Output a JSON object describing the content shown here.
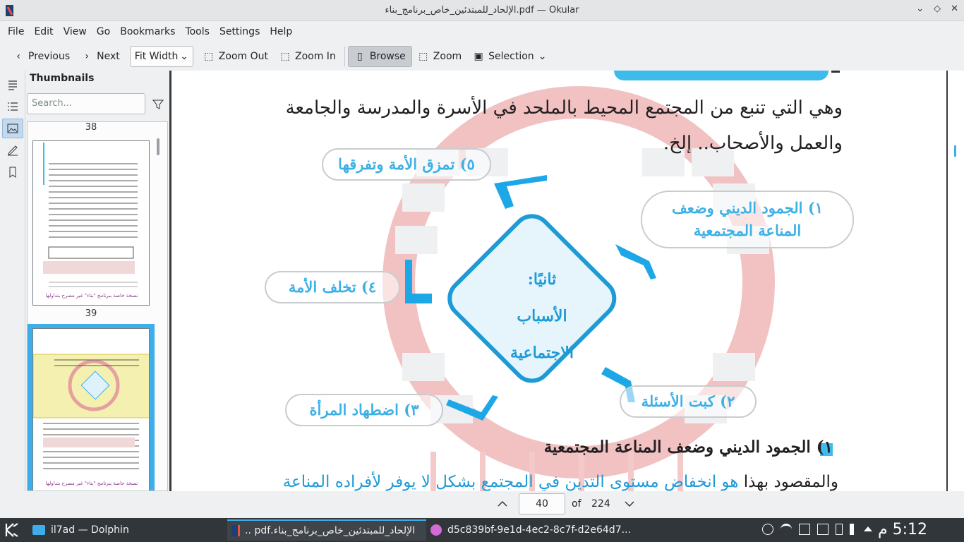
{
  "window": {
    "title": "الإلحاد_للمبتدئين_خاص_برنامج_بناء.pdf — Okular"
  },
  "menu": [
    "File",
    "Edit",
    "View",
    "Go",
    "Bookmarks",
    "Tools",
    "Settings",
    "Help"
  ],
  "toolbar": {
    "previous": "Previous",
    "next": "Next",
    "zoom_mode": "Fit Width",
    "zoom_out": "Zoom Out",
    "zoom_in": "Zoom In",
    "browse": "Browse",
    "zoom": "Zoom",
    "selection": "Selection"
  },
  "sidebar": {
    "heading": "Thumbnails",
    "search_placeholder": "Search...",
    "thumbnails": [
      {
        "page": "38"
      },
      {
        "page": "39"
      },
      {
        "page": "40",
        "selected": true
      }
    ],
    "thumb_footer": "نسخة خاصة ببرنامج \"بناء\" غير مصرح بتداولها"
  },
  "document": {
    "para1": "وهي التي تنبع من المجتمع المحيط بالملحد في الأسرة والمدرسة والجامعة والعمل والأصحاب.. إلخ.",
    "center_lines": [
      "ثانيًا:",
      "الأسباب",
      "الاجتماعية"
    ],
    "items": [
      {
        "text": "١) الجمود الديني وضعف المناعة المجتمعية"
      },
      {
        "text": "٢) كبت الأسئلة"
      },
      {
        "text": "٣) اضطهاد المرأة"
      },
      {
        "text": "٤) تخلف الأمة"
      },
      {
        "text": "٥) تمزق الأمة وتفرقها"
      }
    ],
    "heading2": "١) الجمود الديني وضعف المناعة المجتمعية",
    "para2_start": "والمقصود بهذا ",
    "para2_highlight": "هو انخفاض مستوى التدين في المجتمع بشكل لا يوفر لأفراده المناعة"
  },
  "pagenav": {
    "current": "40",
    "of": "of",
    "total": "224"
  },
  "taskbar": {
    "tasks": [
      {
        "label": "il7ad — Dolphin"
      },
      {
        "label": "الإلحاد_للمبتدئين_خاص_برنامج_بناء.pdf ..."
      },
      {
        "label": "d5c839bf-9e1d-4ec2-8c7f-d2e64d7..."
      }
    ],
    "clock": "5:12 م"
  },
  "colors": {
    "accent": "#3daee9",
    "diagram_blue": "#3db0e6",
    "watermark_red": "#e57373"
  }
}
